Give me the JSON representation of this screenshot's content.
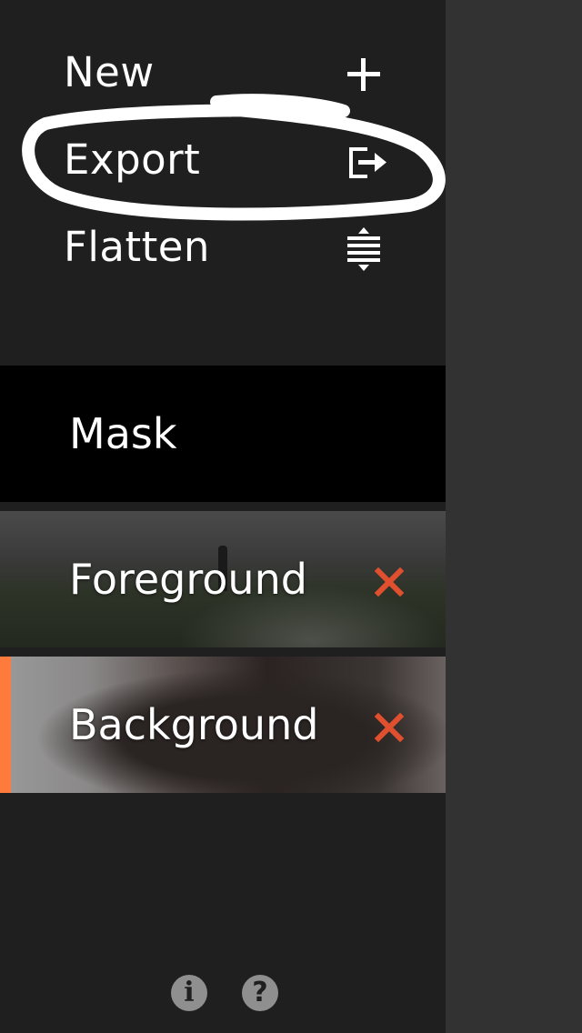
{
  "menu": {
    "items": [
      {
        "label": "New",
        "icon": "plus-icon"
      },
      {
        "label": "Export",
        "icon": "export-icon"
      },
      {
        "label": "Flatten",
        "icon": "flatten-icon"
      }
    ]
  },
  "layers": [
    {
      "label": "Mask",
      "deletable": false,
      "active": false
    },
    {
      "label": "Foreground",
      "deletable": true,
      "active": false
    },
    {
      "label": "Background",
      "deletable": true,
      "active": true
    }
  ],
  "footer": {
    "info_glyph": "i",
    "help_glyph": "?"
  },
  "colors": {
    "panel_bg": "#1f1f1f",
    "right_bg": "#323232",
    "accent": "#ff7a3d",
    "delete": "#e0502e"
  }
}
